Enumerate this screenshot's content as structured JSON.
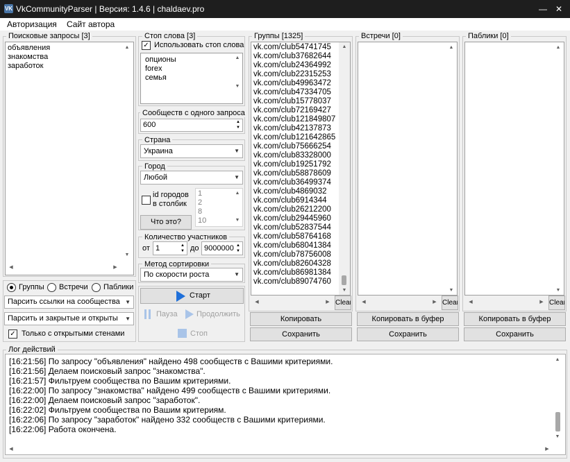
{
  "window": {
    "logo_text": "VK",
    "title": "VkCommunityParser | Версия: 1.4.6 | chaldaev.pro",
    "min_glyph": "—",
    "close_glyph": "✕"
  },
  "menu": [
    "Авторизация",
    "Сайт автора"
  ],
  "queries": {
    "label": "Поисковые запросы [3]",
    "items": [
      "объявления",
      "знакомства",
      "заработок"
    ]
  },
  "stopwords": {
    "label": "Стоп слова [3]",
    "use_label": "Использовать стоп слова",
    "use_checked": true,
    "items": [
      "опционы",
      "forex",
      "семья"
    ]
  },
  "per_query": {
    "label": "Сообществ с одного запроса",
    "value": "600"
  },
  "country": {
    "label": "Страна",
    "value": "Украина"
  },
  "city": {
    "label": "Город",
    "value": "Любой",
    "ids_label": "id городов\nв столбик",
    "ids_checked": false,
    "ids": [
      "1",
      "2",
      "8",
      "10"
    ],
    "help_button": "Что это?"
  },
  "members": {
    "label": "Количество участников",
    "from_label": "от",
    "from": "1",
    "to_label": "до",
    "to": "9000000"
  },
  "sort": {
    "label": "Метод сортировки",
    "value": "По скорости роста"
  },
  "controls": {
    "start": "Старт",
    "pause": "Пауза",
    "resume": "Продолжить",
    "stop": "Стоп"
  },
  "type_radios": {
    "options": [
      "Группы",
      "Встречи",
      "Паблики"
    ],
    "selected": 0
  },
  "parse_links": {
    "value": "Парсить ссылки на сообщества"
  },
  "parse_closed": {
    "value": "Парсить и закрытые и открыты"
  },
  "open_walls": {
    "label": "Только с открытыми стенами",
    "checked": true
  },
  "groups": {
    "label": "Группы [1325]",
    "items": [
      "vk.com/club54741745",
      "vk.com/club37682644",
      "vk.com/club24364992",
      "vk.com/club22315253",
      "vk.com/club49963472",
      "vk.com/club47334705",
      "vk.com/club15778037",
      "vk.com/club72169427",
      "vk.com/club121849807",
      "vk.com/club42137873",
      "vk.com/club121642865",
      "vk.com/club75666254",
      "vk.com/club83328000",
      "vk.com/club19251792",
      "vk.com/club58878609",
      "vk.com/club36499374",
      "vk.com/club4869032",
      "vk.com/club6914344",
      "vk.com/club26212200",
      "vk.com/club29445960",
      "vk.com/club52837544",
      "vk.com/club58764168",
      "vk.com/club68041384",
      "vk.com/club78756008",
      "vk.com/club82604328",
      "vk.com/club86981384",
      "vk.com/club89074760"
    ],
    "clear": "Clear",
    "copy": "Копировать",
    "save": "Сохранить"
  },
  "meetings": {
    "label": "Встречи [0]",
    "clear": "Clear",
    "copy": "Копировать в буфер",
    "save": "Сохранить"
  },
  "publics": {
    "label": "Паблики [0]",
    "clear": "Clear",
    "copy": "Копировать в буфер",
    "save": "Сохранить"
  },
  "log": {
    "label": "Лог действий",
    "lines": [
      "[16:21:56] По запросу \"объявления\" найдено 498 сообществ с Вашими критериями.",
      "[16:21:56] Делаем поисковый запрос \"знакомства\".",
      "[16:21:57] Фильтруем сообщества по Вашим критериями.",
      "[16:22:00] По запросу \"знакомства\" найдено 499 сообществ с Вашими критериями.",
      "[16:22:00] Делаем поисковый запрос \"заработок\".",
      "[16:22:02] Фильтруем сообщества по Вашим критериям.",
      "[16:22:06] По запросу \"заработок\" найдено 332 сообществ с Вашими критериями.",
      "[16:22:06] Работа окончена."
    ]
  },
  "colors": {
    "titlebar": "#1e1e1e",
    "start_icon": "#1e6fd9",
    "menubar": "#ffffff"
  },
  "icons": {
    "start": "play-icon",
    "pause": "pause-icon",
    "resume": "play-icon",
    "stop": "stop-icon"
  }
}
